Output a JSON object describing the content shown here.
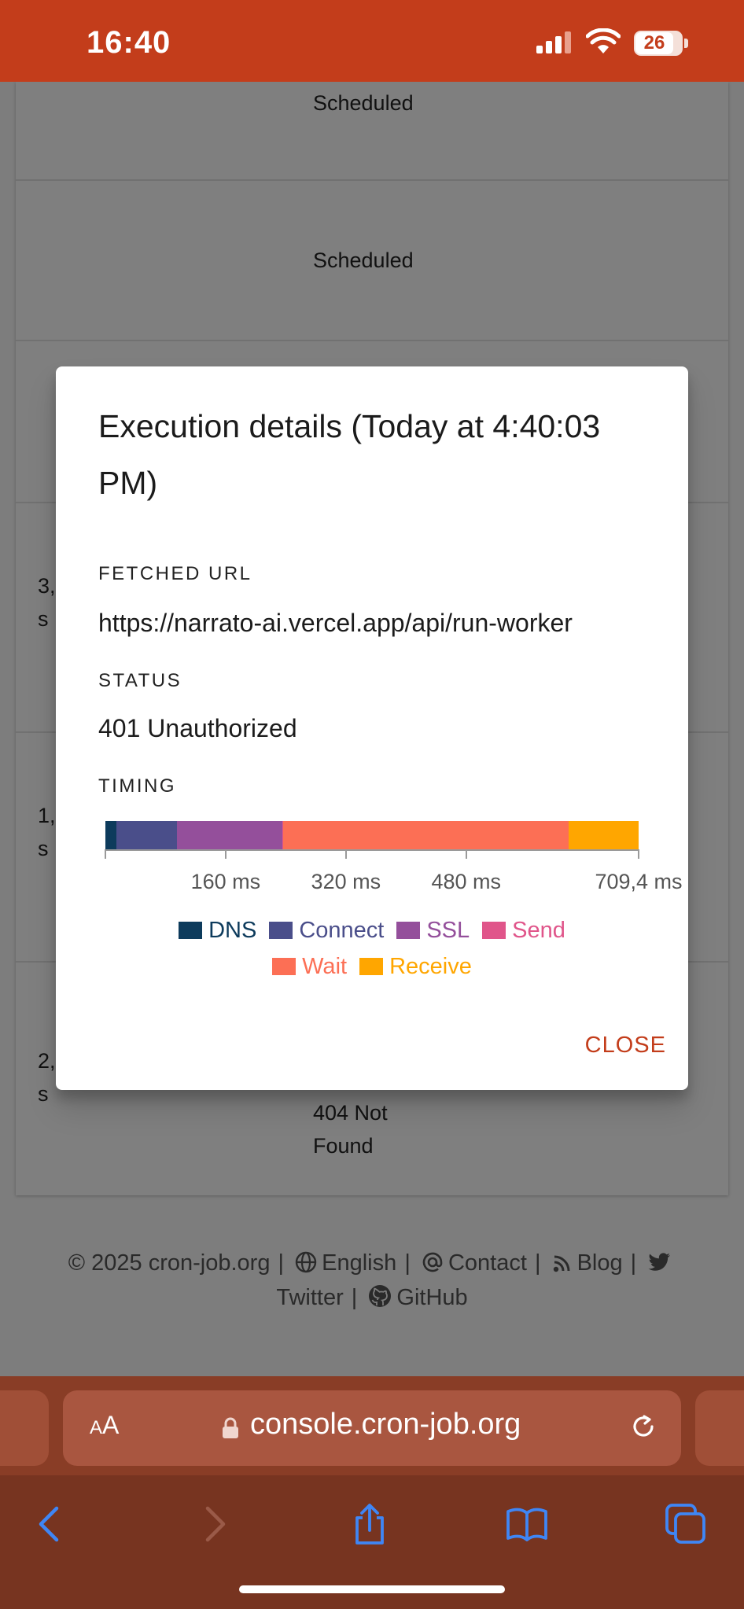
{
  "status_bar": {
    "time": "16:40",
    "battery": "26"
  },
  "background": {
    "rows": [
      {
        "status": "Scheduled",
        "duration": ""
      },
      {
        "status": "Scheduled",
        "duration": ""
      },
      {
        "status": "",
        "duration": ""
      },
      {
        "status": "",
        "duration": "3,\ns"
      },
      {
        "status": "",
        "duration": "1,\ns"
      },
      {
        "status": "404 Not\nFound",
        "duration": "2,\ns"
      }
    ]
  },
  "dialog": {
    "title": "Execution details (Today at 4:40:03 PM)",
    "fetched_url_label": "FETCHED URL",
    "fetched_url": "https://narrato-ai.vercel.app/api/run-worker",
    "status_label": "STATUS",
    "status": "401 Unauthorized",
    "timing_label": "TIMING",
    "close_label": "CLOSE"
  },
  "chart_data": {
    "type": "bar",
    "orientation": "horizontal-stacked",
    "unit": "ms",
    "total": 709.4,
    "segments": [
      {
        "name": "DNS",
        "value": 15,
        "color": "#0d3b5c"
      },
      {
        "name": "Connect",
        "value": 80,
        "color": "#4a4e8a"
      },
      {
        "name": "SSL",
        "value": 140,
        "color": "#944f9b"
      },
      {
        "name": "Send",
        "value": 1,
        "color": "#e0558a"
      },
      {
        "name": "Wait",
        "value": 380,
        "color": "#fc6f55"
      },
      {
        "name": "Receive",
        "value": 93.4,
        "color": "#ffa600"
      }
    ],
    "ticks": [
      {
        "value": 160,
        "label": "160 ms"
      },
      {
        "value": 320,
        "label": "320 ms"
      },
      {
        "value": 480,
        "label": "480 ms"
      },
      {
        "value": 709.4,
        "label": "709,4 ms"
      }
    ],
    "legend_placement": "bottom"
  },
  "footer": {
    "copyright": "© 2025 cron-job.org",
    "separator": "|",
    "language": "English",
    "contact": "Contact",
    "blog": "Blog",
    "twitter": "Twitter",
    "github": "GitHub"
  },
  "browser": {
    "aa_small": "A",
    "aa_large": "A",
    "host": "console.cron-job.org"
  }
}
